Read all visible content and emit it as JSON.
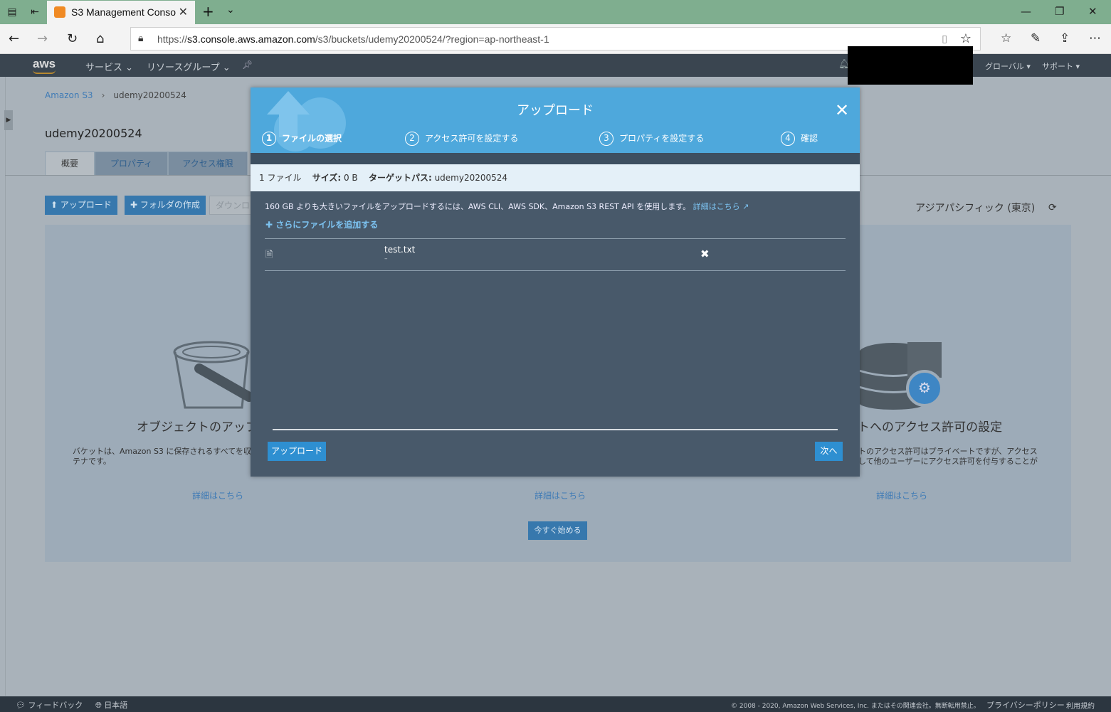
{
  "browser": {
    "tab_title": "S3 Management Conso",
    "url_prefix": "https://",
    "url_host": "s3.console.aws.amazon.com",
    "url_path": "/s3/buckets/udemy20200524/?region=ap-northeast-1"
  },
  "awsnav": {
    "services": "サービス ⌄",
    "resource_groups": "リソースグループ ⌄",
    "global": "グローバル ▾",
    "support": "サポート ▾"
  },
  "page": {
    "breadcrumb_root": "Amazon S3",
    "breadcrumb_bucket": "udemy20200524",
    "bucket_title": "udemy20200524",
    "tabs": [
      "概要",
      "プロパティ",
      "アクセス権限"
    ],
    "buttons": {
      "upload": "アップロード",
      "create_folder": "フォルダの作成",
      "download": "ダウンロー"
    },
    "region": "アジアパシフィック (東京)",
    "cards": [
      {
        "title": "オブジェクトのアップ",
        "desc1": "バケットは、Amazon S3 に保存されるすべてを収納",
        "desc2": "テナです。",
        "link": "詳細はこちら"
      },
      {
        "link": "詳細はこちら"
      },
      {
        "title": "トへのアクセス許可の設定",
        "desc1": "トのアクセス許可はプライベートですが、アクセス",
        "desc2": "して他のユーザーにアクセス許可を付与することが",
        "link": "詳細はこちら"
      }
    ],
    "start_button": "今すぐ始める"
  },
  "footer": {
    "feedback": "フィードバック",
    "language": "日本語",
    "copyright": "© 2008 - 2020, Amazon Web Services, Inc. またはその関連会社。無断転用禁止。",
    "privacy": "プライバシーポリシー",
    "terms": "利用規約"
  },
  "modal": {
    "title": "アップロード",
    "steps": [
      {
        "num": "1",
        "label": "ファイルの選択"
      },
      {
        "num": "2",
        "label": "アクセス許可を設定する"
      },
      {
        "num": "3",
        "label": "プロパティを設定する"
      },
      {
        "num": "4",
        "label": "確認"
      }
    ],
    "summary_count": "1 ファイル",
    "summary_size_label": "サイズ:",
    "summary_size": " 0 B",
    "summary_path_label": "ターゲットパス:",
    "summary_path": " udemy20200524",
    "info_text": "160 GB よりも大きいファイルをアップロードするには、AWS CLI、AWS SDK、Amazon S3 REST API を使用します。",
    "info_link": "詳細はこちら",
    "add_more": "さらにファイルを追加する",
    "file_name": "test.txt",
    "file_size": "–",
    "upload_button": "アップロード",
    "next_button": "次へ"
  }
}
